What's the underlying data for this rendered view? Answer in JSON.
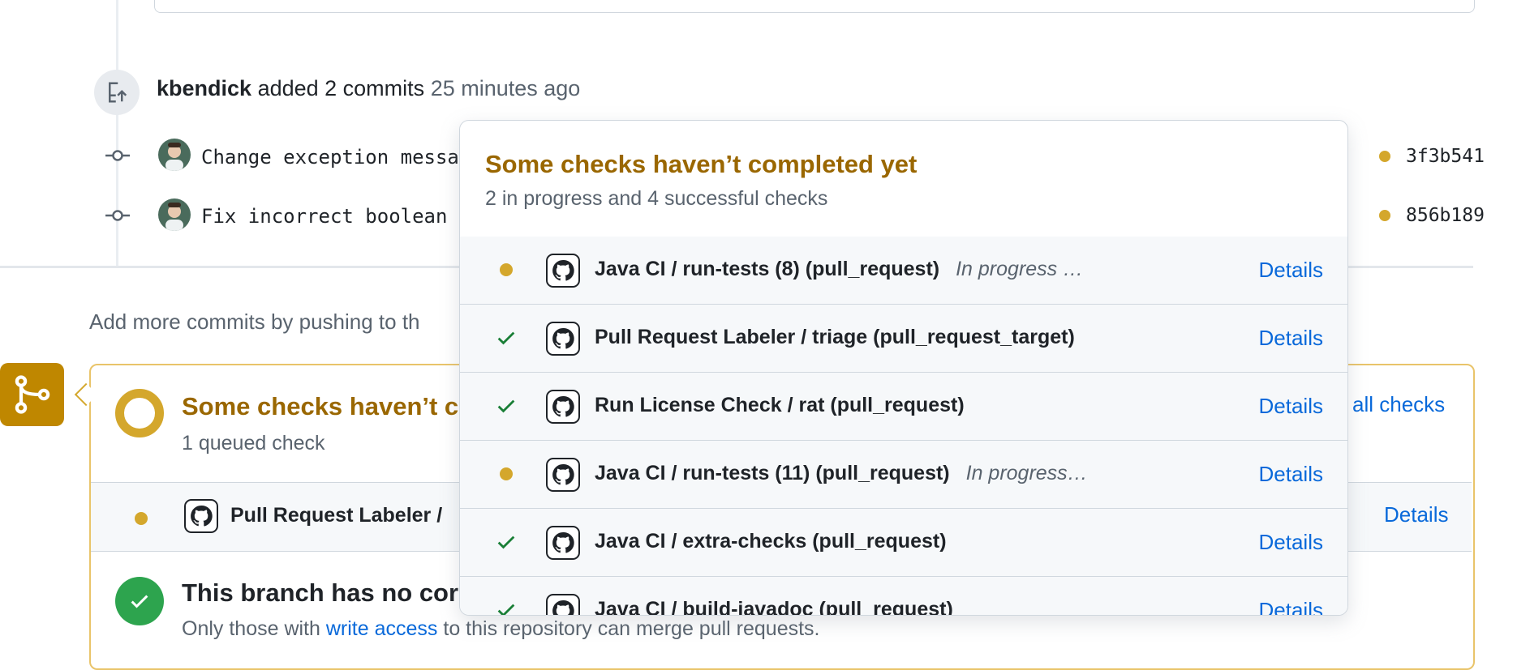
{
  "timeline": {
    "event": {
      "actor": "kbendick",
      "action": "added 2 commits",
      "time": "25 minutes ago"
    },
    "commits": [
      {
        "message": "Change exception messa",
        "sha": "3f3b541"
      },
      {
        "message": "Fix incorrect boolean",
        "sha": "856b189"
      }
    ],
    "hint": "Add more commits by pushing to th"
  },
  "merge_box": {
    "title": "Some checks haven’t c",
    "subtitle": "1 queued check",
    "show_all": "all checks",
    "queued_check": {
      "name": "Pull Request Labeler /",
      "details": "Details"
    },
    "branch_title": "This branch has no cor",
    "branch_sub_prefix": "Only those with",
    "branch_sub_link": "write access",
    "branch_sub_suffix": "to this repository can merge pull requests."
  },
  "popover": {
    "title": "Some checks haven’t completed yet",
    "subtitle": "2 in progress and 4 successful checks",
    "checks": [
      {
        "name": "Java CI / run-tests (8) (pull_request)",
        "state": "In progress …",
        "status": "pending",
        "details": "Details"
      },
      {
        "name": "Pull Request Labeler / triage (pull_request_target)",
        "state": "",
        "status": "success",
        "details": "Details"
      },
      {
        "name": "Run License Check / rat (pull_request)",
        "state": "",
        "status": "success",
        "details": "Details"
      },
      {
        "name": "Java CI / run-tests (11) (pull_request)",
        "state": "In progress…",
        "status": "pending",
        "details": "Details"
      },
      {
        "name": "Java CI / extra-checks (pull_request)",
        "state": "",
        "status": "success",
        "details": "Details"
      },
      {
        "name": "Java CI / build-javadoc (pull_request)",
        "state": "",
        "status": "success",
        "details": "Details"
      }
    ]
  },
  "colors": {
    "pending": "#d4a72c",
    "success": "#2da44e",
    "link": "#0969da",
    "warning_title": "#9a6700"
  }
}
